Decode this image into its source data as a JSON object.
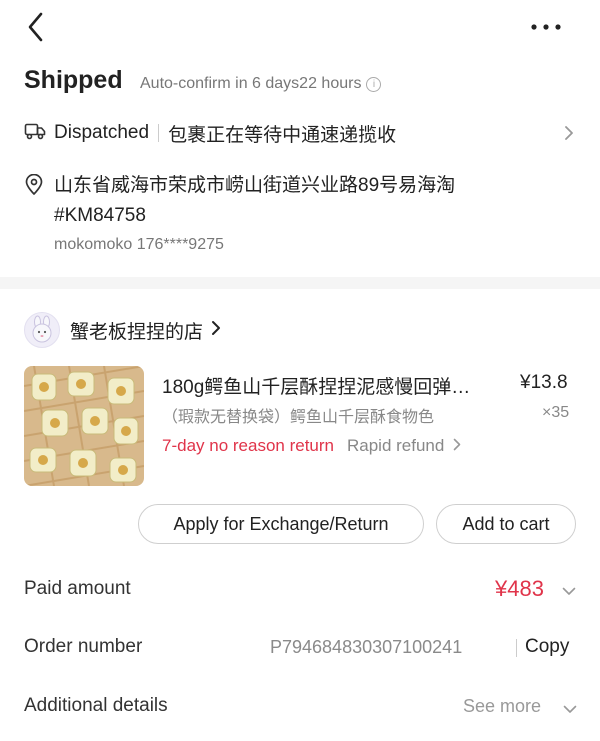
{
  "status": {
    "title": "Shipped",
    "auto_confirm": "Auto-confirm in 6 days22 hours",
    "info_glyph": "i"
  },
  "shipping": {
    "label": "Dispatched",
    "text": "包裹正在等待中通速递揽收",
    "icon": "truck-icon"
  },
  "address": {
    "text": "山东省威海市荣成市崂山街道兴业路89号易海淘#KM84758",
    "contact": "mokomoko 176****9275",
    "icon": "location-pin-icon"
  },
  "shop": {
    "name": "蟹老板捏捏的店"
  },
  "product": {
    "title": "180g鳄鱼山千层酥捏捏泥感慢回弹…",
    "price": "¥13.8",
    "variant": "（瑕款无替换袋）鳄鱼山千层酥食物色",
    "qty": "×35",
    "return_policy": "7-day no reason return",
    "refund": "Rapid refund"
  },
  "actions": {
    "exchange": "Apply for Exchange/Return",
    "cart": "Add to cart"
  },
  "details": {
    "paid_label": "Paid amount",
    "paid_value": "¥483",
    "order_label": "Order number",
    "order_number": "P794684830307100241",
    "copy": "Copy",
    "additional_label": "Additional details",
    "see_more": "See more"
  },
  "colors": {
    "accent_red": "#e0344a",
    "muted_text": "#888888",
    "divider": "#f5f5f5"
  }
}
